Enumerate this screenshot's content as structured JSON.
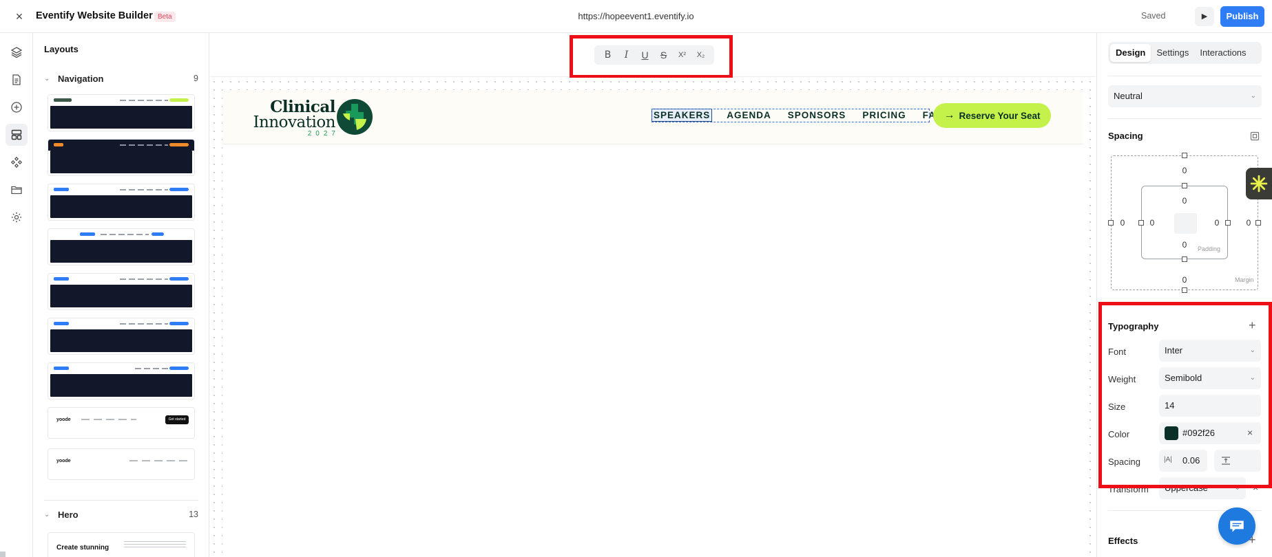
{
  "app": {
    "title": "Eventify Website Builder",
    "badge": "Beta",
    "url": "https://hopeevent1.eventify.io",
    "saved_label": "Saved",
    "play_icon": "▶",
    "publish_label": "Publish",
    "close_icon": "×"
  },
  "rail": {
    "icons": [
      "layers-icon",
      "page-icon",
      "add-icon",
      "layouts-icon",
      "components-icon",
      "folder-icon",
      "settings-icon"
    ]
  },
  "layouts_panel": {
    "title": "Layouts",
    "navigation": {
      "label": "Navigation",
      "count": "9"
    },
    "nav_thumb_6_logo": "yoode",
    "nav_thumb_6_links": "Features   Pricing   Blog   Contact",
    "nav_thumb_6_button": "Get started",
    "nav_thumb_7_logo": "yoode",
    "nav_thumb_7_links": "Features   Pricing   Blog   Contact",
    "hero": {
      "label": "Hero",
      "count": "13",
      "thumb_title": "Create stunning"
    }
  },
  "format_toolbar": {
    "bold": "B",
    "italic": "I",
    "underline": "U",
    "strikethrough": "S",
    "superscript": "X²",
    "subscript": "X₂"
  },
  "site": {
    "logo_line1": "Clinical",
    "logo_line2": "Innovation",
    "logo_year": "2027",
    "nav": [
      "SPEAKERS",
      "AGENDA",
      "SPONSORS",
      "PRICING",
      "FAQ"
    ],
    "cta": "Reserve Your Seat",
    "cta_arrow": "→",
    "colors": {
      "brand_dark": "#092f26",
      "brand_green": "#1a9a5a",
      "cta_bg": "#c5f24a",
      "header_bg": "#fefcf6"
    }
  },
  "design_panel": {
    "tabs": [
      "Design",
      "Settings",
      "Interactions"
    ],
    "active_tab": "Design",
    "preset": "Neutral",
    "spacing": {
      "title": "Spacing",
      "margin_label": "Margin",
      "padding_label": "Padding",
      "margin": {
        "top": "0",
        "right": "0",
        "bottom": "0",
        "left": "0"
      },
      "padding": {
        "top": "0",
        "right": "0",
        "bottom": "0",
        "left": "0"
      }
    },
    "typography": {
      "title": "Typography",
      "font_label": "Font",
      "font_value": "Inter",
      "weight_label": "Weight",
      "weight_value": "Semibold",
      "size_label": "Size",
      "size_value": "14",
      "color_label": "Color",
      "color_value": "#092f26",
      "color_clear": "×",
      "spacing_label": "Spacing",
      "letter_spacing_icon": "|A|",
      "letter_spacing_value": "0.06",
      "transform_label": "Transform",
      "transform_value": "Uppercase",
      "transform_clear": "×"
    },
    "effects": {
      "title": "Effects"
    }
  },
  "highlight_color": "#ee0e17",
  "accent_color": "#2f7df6"
}
